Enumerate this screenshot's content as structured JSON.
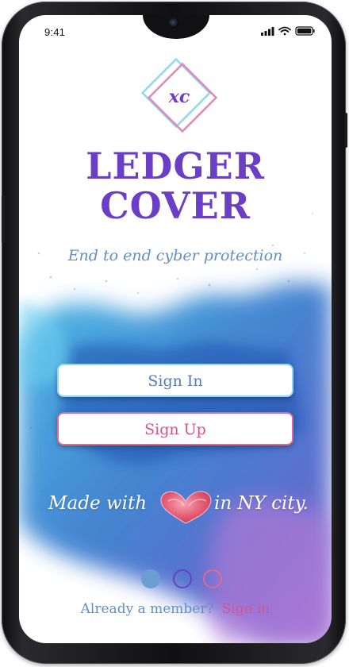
{
  "status_bar": {
    "time": "9:41",
    "icons": [
      "cellular-signal-icon",
      "wifi-icon",
      "battery-icon"
    ]
  },
  "brand": {
    "logo_monogram": "xc",
    "name_line1": "LEDGER",
    "name_line2": "COVER",
    "tagline": "End to end cyber protection"
  },
  "buttons": {
    "sign_in": "Sign In",
    "sign_up": "Sign Up"
  },
  "made_with": {
    "prefix": "Made with",
    "suffix": "in NY city.",
    "icon": "heart-icon"
  },
  "pagination": {
    "count": 3,
    "active": 1
  },
  "footer": {
    "question": "Already a member?",
    "link": "Sign in"
  },
  "colors": {
    "brand_purple": "#6a3fc6",
    "accent_blue": "#5f8fc6",
    "accent_pink": "#d5558a",
    "logo_cyan": "#8fd8ee"
  }
}
